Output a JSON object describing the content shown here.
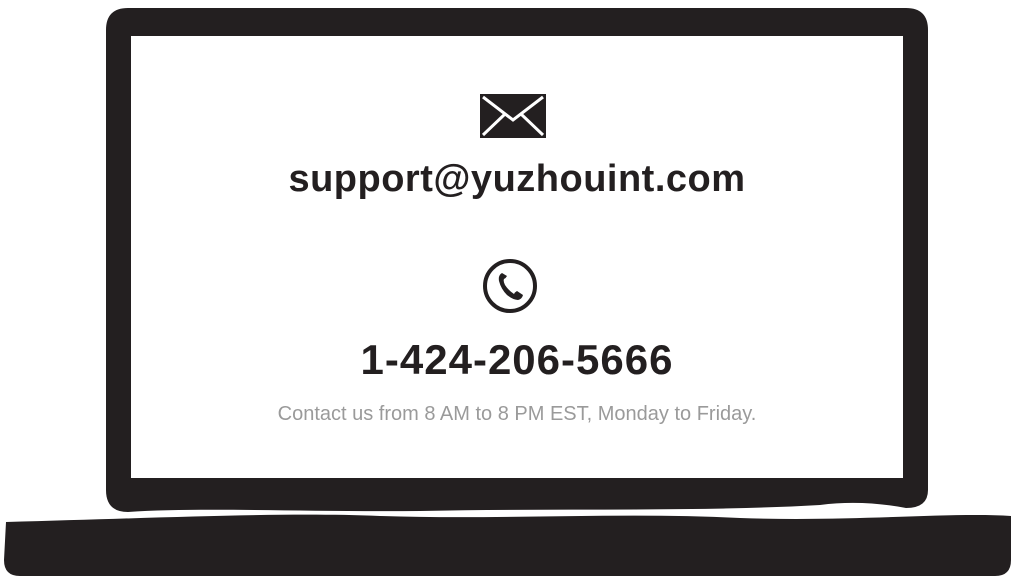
{
  "contact": {
    "email": "support@yuzhouint.com",
    "phone": "1-424-206-5666",
    "hours": "Contact us from 8 AM to 8 PM EST, Monday to Friday."
  },
  "icons": {
    "email": "envelope-icon",
    "phone": "phone-icon"
  },
  "colors": {
    "frame": "#231f20",
    "text": "#231f20",
    "muted_text": "#9a9a9a",
    "screen": "#ffffff"
  }
}
